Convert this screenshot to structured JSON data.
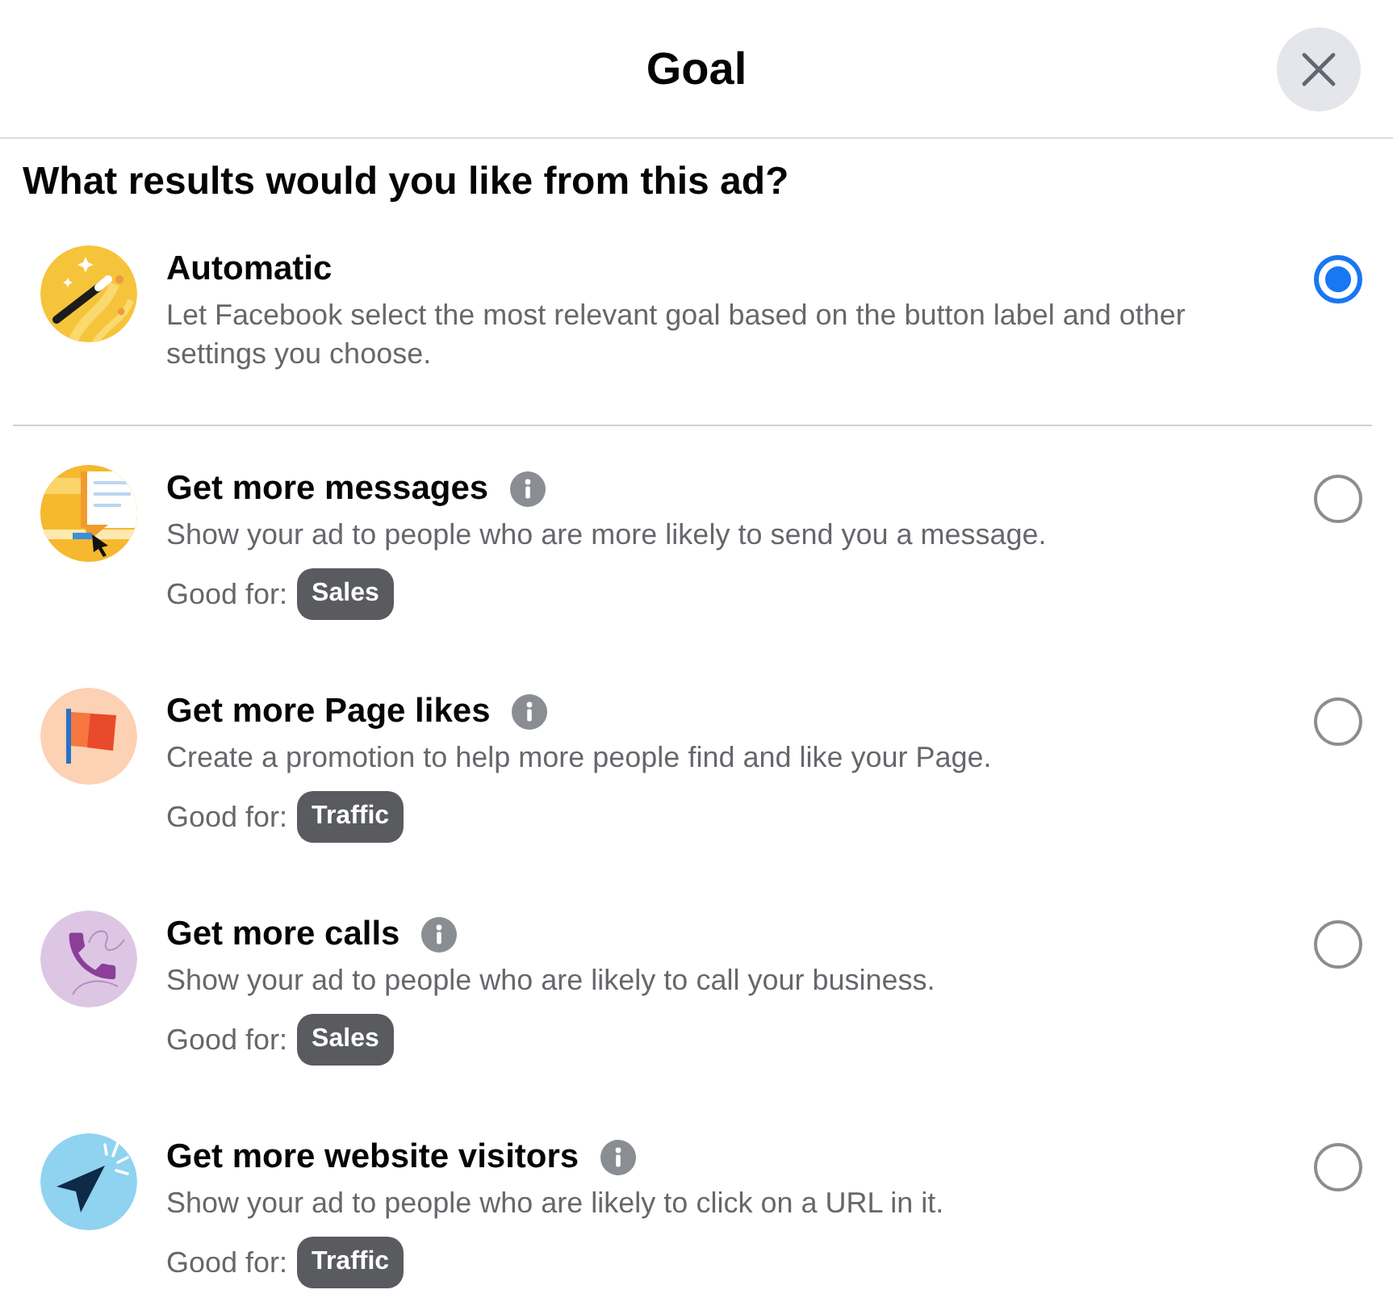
{
  "dialog": {
    "title": "Goal"
  },
  "question": "What results would you like from this ad?",
  "options": [
    {
      "kind": "automatic",
      "title": "Automatic",
      "info": false,
      "description": "Let Facebook select the most relevant goal based on the button label and other settings you choose.",
      "selected": true
    },
    {
      "kind": "messages",
      "title": "Get more messages",
      "info": true,
      "description": "Show your ad to people who are more likely to send you a message.",
      "good_for": {
        "label": "Good for:",
        "tag": "Sales"
      },
      "selected": false
    },
    {
      "kind": "likes",
      "title": "Get more Page likes",
      "info": true,
      "description": "Create a promotion to help more people find and like your Page.",
      "good_for": {
        "label": "Good for:",
        "tag": "Traffic"
      },
      "selected": false
    },
    {
      "kind": "calls",
      "title": "Get more calls",
      "info": true,
      "description": "Show your ad to people who are likely to call your business.",
      "good_for": {
        "label": "Good for:",
        "tag": "Sales"
      },
      "selected": false
    },
    {
      "kind": "visitors",
      "title": "Get more website visitors",
      "info": true,
      "description": "Show your ad to people who are likely to click on a URL in it.",
      "good_for": {
        "label": "Good for:",
        "tag": "Traffic"
      },
      "selected": false
    }
  ]
}
